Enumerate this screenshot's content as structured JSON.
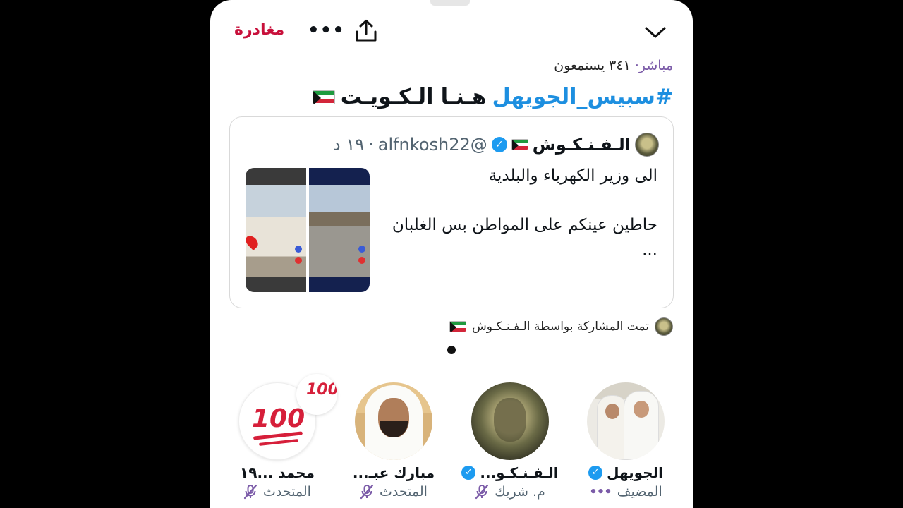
{
  "header": {
    "leave_label": "مغادرة",
    "more_label": "•••",
    "share_icon": "share-icon",
    "collapse_icon": "chevron-down-icon"
  },
  "space": {
    "live_label": "مباشر",
    "separator": "·",
    "listeners_text": "٣٤١ يستمعون",
    "hashtag": "#سبيس_الجويهل",
    "title_text": "هـنـا الـكـويـت",
    "flag_icon": "kuwait-flag-icon"
  },
  "tweet": {
    "author": "الـفـنـكـوش",
    "handle": "@alfnkosh22",
    "separator": "·",
    "time": "١٩ د",
    "lines": [
      "الى وزير الكهرباء والبلدية",
      "حاطين عينكم على المواطن بس الغلبان",
      "..."
    ]
  },
  "shared_by": {
    "text": "تمت المشاركة بواسطة الـفـنـكـوش"
  },
  "participants": [
    {
      "name": "الجويهل",
      "role": "المضيف",
      "verified": true
    },
    {
      "name": "الـفـنـكـو...",
      "role": "م. شريك",
      "verified": true
    },
    {
      "name": "مبارك عبـ...",
      "role": "المتحدث",
      "verified": false
    },
    {
      "name": "محمد ...١٩",
      "role": "المتحدث",
      "verified": false
    }
  ],
  "avatar_emoji_text": "100",
  "colors": {
    "accent_purple": "#7b5ba8",
    "leave_red": "#c8103b",
    "hashtag_blue": "#1d8fe0",
    "verified_blue": "#1d9bf0",
    "emoji_red": "#d61f3a"
  }
}
